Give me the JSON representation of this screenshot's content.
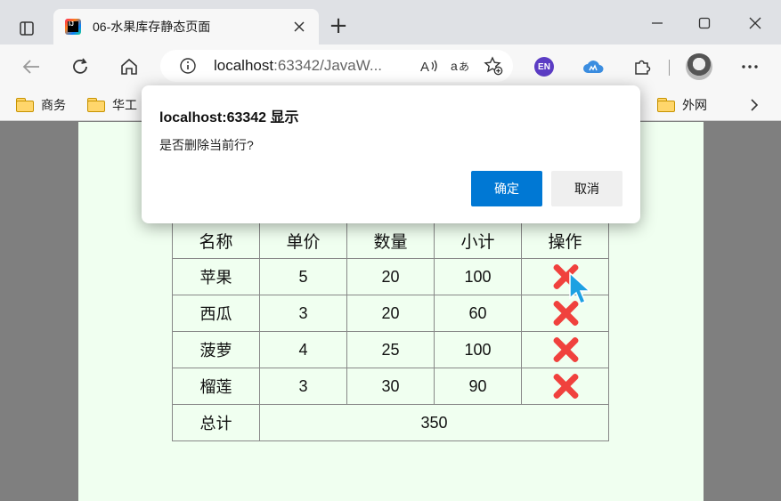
{
  "browser": {
    "tab_title": "06-水果库存静态页面",
    "favicon_text": "IJ",
    "address_host": "localhost",
    "address_rest": ":63342/JavaW...",
    "extension_en_label": "EN"
  },
  "bookmarks": [
    {
      "label": "商务"
    },
    {
      "label": "华工"
    },
    {
      "label": "外网"
    }
  ],
  "dialog": {
    "title": "localhost:63342 显示",
    "message": "是否删除当前行?",
    "ok_label": "确定",
    "cancel_label": "取消"
  },
  "table": {
    "headers": [
      "名称",
      "单价",
      "数量",
      "小计",
      "操作"
    ],
    "rows": [
      {
        "name": "苹果",
        "price": "5",
        "qty": "20",
        "subtotal": "100"
      },
      {
        "name": "西瓜",
        "price": "3",
        "qty": "20",
        "subtotal": "60"
      },
      {
        "name": "菠萝",
        "price": "4",
        "qty": "25",
        "subtotal": "100"
      },
      {
        "name": "榴莲",
        "price": "3",
        "qty": "30",
        "subtotal": "90"
      }
    ],
    "total_label": "总计",
    "total_value": "350"
  },
  "colors": {
    "page_bg": "#f0fff0",
    "delete_icon": "#f0413d",
    "ok_button": "#0078d4"
  }
}
